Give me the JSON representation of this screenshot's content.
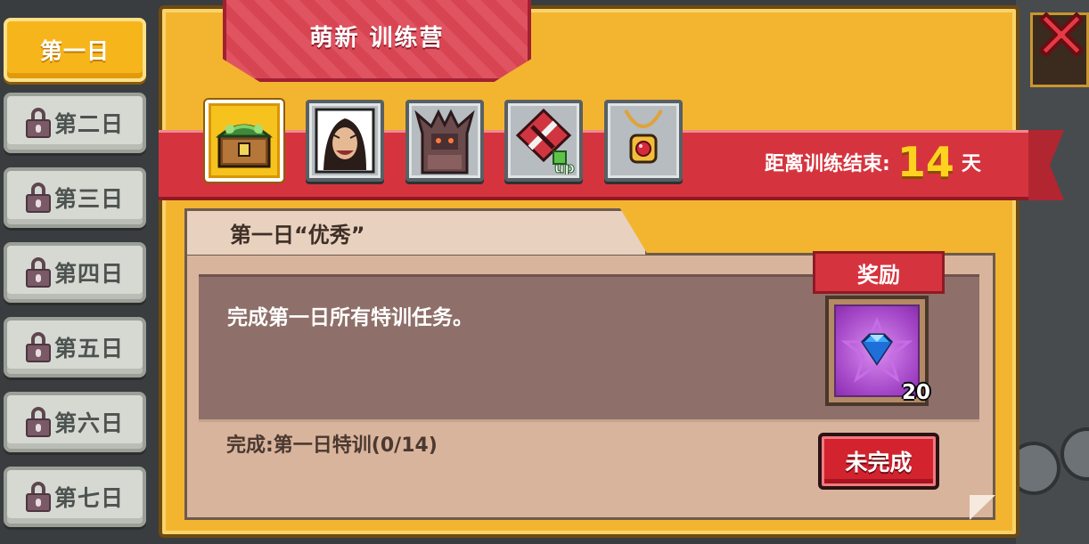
{
  "sidebar": {
    "days": [
      {
        "label": "第一日",
        "locked": false,
        "active": true
      },
      {
        "label": "第二日",
        "locked": true,
        "active": false
      },
      {
        "label": "第三日",
        "locked": true,
        "active": false
      },
      {
        "label": "第四日",
        "locked": true,
        "active": false
      },
      {
        "label": "第五日",
        "locked": true,
        "active": false
      },
      {
        "label": "第六日",
        "locked": true,
        "active": false
      },
      {
        "label": "第七日",
        "locked": true,
        "active": false
      }
    ]
  },
  "header": {
    "title": "萌新 训练营",
    "countdown_prefix": "距离训练结束:",
    "countdown_value": "14",
    "countdown_unit": "天"
  },
  "icon_tabs": [
    {
      "icon": "treasure-chest-icon",
      "selected": true
    },
    {
      "icon": "hero-portrait-icon",
      "selected": false
    },
    {
      "icon": "demon-armor-icon",
      "selected": false
    },
    {
      "icon": "weapon-upgrade-icon",
      "badge": "up",
      "selected": false
    },
    {
      "icon": "amulet-icon",
      "selected": false
    }
  ],
  "task": {
    "tab_title": "第一日“优秀”",
    "description": "完成第一日所有特训任务。",
    "progress_text": "完成:第一日特训(0/14)",
    "reward_label": "奖励",
    "reward_item": "diamond-gem-icon",
    "reward_count": "20",
    "status_label": "未完成"
  },
  "colors": {
    "panel": "#f3b530",
    "band": "#d5343e",
    "countdown_number": "#ffd21f"
  }
}
